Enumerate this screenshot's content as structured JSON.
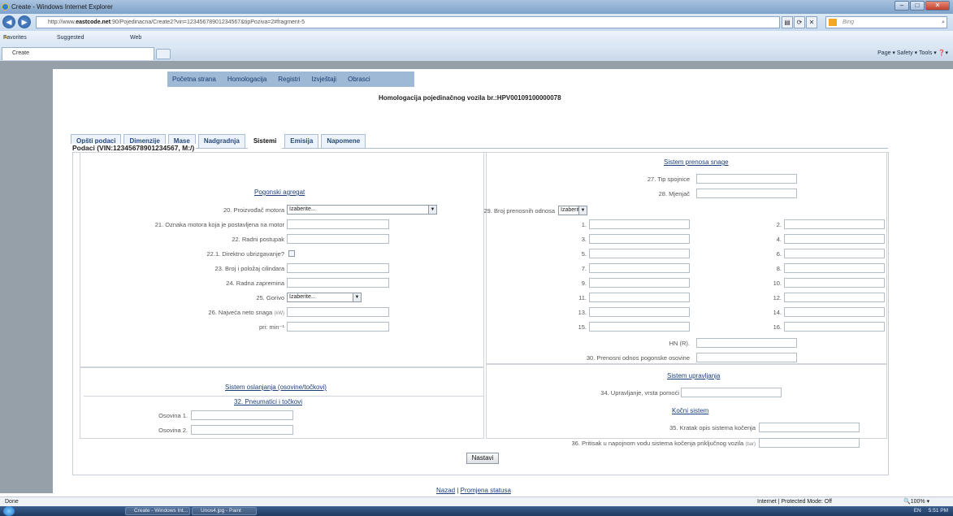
{
  "window": {
    "title": "Create - Windows Internet Explorer",
    "min": "–",
    "max": "□",
    "close": "✕"
  },
  "browser": {
    "back": "◀",
    "forward": "▶",
    "url_prefix": "http://www.",
    "url_domain": "eastcode.net",
    "url_rest": ":90/Pojedinacna/Create2?vin=12345678901234567&tipPoziva=2#fragment-5",
    "search_placeholder": "Bing",
    "search_icon": "⌕",
    "favorites": "Favorites",
    "suggested": "Suggested Sites ▾",
    "webslice": "Web Slice Gallery ▾",
    "tab_title": "Create",
    "commands": "Page ▾   Safety ▾   Tools ▾   ❓▾"
  },
  "menu": [
    "Početna strana",
    "Homologacija",
    "Registri",
    "Izvještaji",
    "Obrasci"
  ],
  "heading": "Homologacija pojedinačnog vozila br.:HPV00109100000078",
  "tabs": [
    "Opšti podaci",
    "Dimenzije",
    "Mase",
    "Nadgradnja",
    "Sistemi",
    "Emisija",
    "Napomene"
  ],
  "legend": "Podaci (VIN:12345678901234567, M:/)",
  "left": {
    "section_engine": "Pogonski agregat",
    "f20": "20. Proizvođač motora",
    "f21": "21. Oznaka motora koja je postavljena na motor",
    "f22": "22. Radni postupak",
    "f22_1": "22.1. Direktno ubrizgavanje?",
    "f23": "23. Broj i položaj cilindara",
    "f24": "24. Radna zapremina",
    "f25": "25. Gorivo",
    "f26": "26. Najveća neto snaga",
    "f26_unit": "(kW)",
    "f_rpm": "pri: min⁻¹",
    "select_default": "Izaberite...",
    "section_suspension": "Sistem oslanjanja (osovine/točkovi)",
    "section_tires": "32. Pneumatici i točkovi",
    "axle1": "Osovina 1.",
    "axle2": "Osovina 2."
  },
  "right": {
    "section_transmission": "Sistem prenosa snage",
    "f27": "27. Tip spojnice",
    "f28": "28. Mjenjač",
    "f29": "29. Broj prenosnih odnosa",
    "gears_left": [
      "1.",
      "3.",
      "5.",
      "7.",
      "9.",
      "11.",
      "13.",
      "15."
    ],
    "gears_right": [
      "2.",
      "4.",
      "6.",
      "8.",
      "10.",
      "12.",
      "14.",
      "16."
    ],
    "hn": "HN (R).",
    "f30": "30. Prenosni odnos pogonske osovine",
    "section_steering": "Sistem upravljanja",
    "f34": "34. Upravljanje, vrsta pomoći",
    "section_brakes": "Kočni sistem",
    "f35": "35. Kratak opis sistema kočenja",
    "f36": "36. Pritisak u napojnom vodu sistema kočenja priključnog vozila",
    "f36_unit": "(bar)"
  },
  "button": "Nastavi",
  "footer": {
    "back": "Nazad",
    "sep": "|",
    "status": "Promjena statusa"
  },
  "statusbar": {
    "left": "Done",
    "zone": "Internet | Protected Mode: Off",
    "zoom": "🔍100% ▾"
  },
  "taskbar": {
    "ie": "Create - Windows Int...",
    "paint": "Unos4.jpg - Paint",
    "lang": "EN",
    "time": "5:51 PM"
  }
}
